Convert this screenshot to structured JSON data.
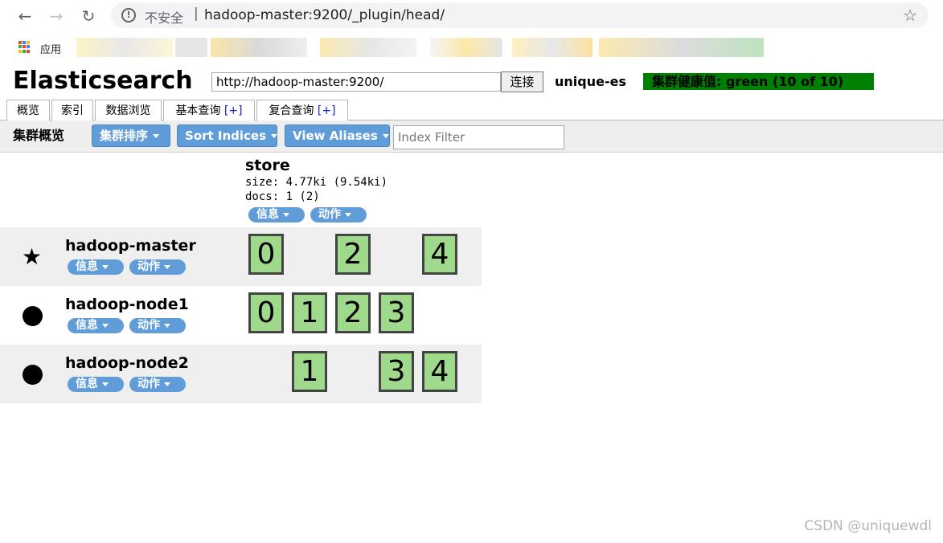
{
  "browser": {
    "back_icon": "back-arrow-icon",
    "forward_icon": "forward-arrow-icon",
    "reload_icon": "reload-icon",
    "security_label": "不安全",
    "url_host": "hadoop-master",
    "url_rest": ":9200/_plugin/head/",
    "bookmark_icon": "star-outline-icon",
    "bookmarks_apps_label": "应用"
  },
  "app": {
    "title": "Elasticsearch",
    "connection_url": "http://hadoop-master:9200/",
    "connect_label": "连接",
    "cluster_name": "unique-es",
    "health_text": "集群健康值: green (10 of 10)",
    "health_color": "#008000"
  },
  "tabs": [
    {
      "label": "概览",
      "plus": ""
    },
    {
      "label": "索引",
      "plus": ""
    },
    {
      "label": "数据浏览",
      "plus": ""
    },
    {
      "label": "基本查询",
      "plus": "[+]"
    },
    {
      "label": "复合查询",
      "plus": "[+]"
    }
  ],
  "toolbar": {
    "title": "集群概览",
    "sort_cluster_label": "集群排序",
    "sort_indices_label": "Sort Indices",
    "view_aliases_label": "View Aliases",
    "index_filter_placeholder": "Index Filter"
  },
  "index": {
    "name": "store",
    "size": "size: 4.77ki (9.54ki)",
    "docs": "docs: 1 (2)",
    "info_label": "信息",
    "action_label": "动作"
  },
  "nodes": [
    {
      "name": "hadoop-master",
      "icon": "star-icon",
      "info_label": "信息",
      "action_label": "动作",
      "shards": [
        "0",
        "",
        "2",
        "",
        "4"
      ]
    },
    {
      "name": "hadoop-node1",
      "icon": "dot-icon",
      "info_label": "信息",
      "action_label": "动作",
      "shards": [
        "0",
        "1",
        "2",
        "3",
        ""
      ]
    },
    {
      "name": "hadoop-node2",
      "icon": "dot-icon",
      "info_label": "信息",
      "action_label": "动作",
      "shards": [
        "",
        "1",
        "",
        "3",
        "4"
      ]
    }
  ],
  "colors": {
    "accent_button": "#5f9cd8",
    "shard_fill": "#9fd98b",
    "row_shade": "#efefef"
  },
  "watermark": "CSDN @uniquewdl"
}
